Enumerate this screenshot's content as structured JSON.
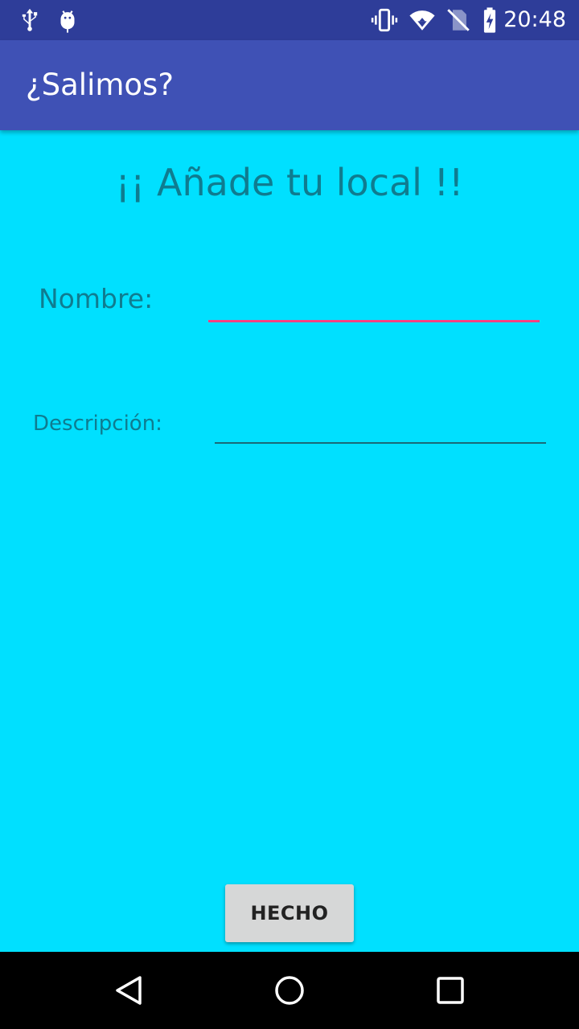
{
  "status_bar": {
    "time": "20:48",
    "left_icons": [
      "usb-icon",
      "android-debug-icon"
    ],
    "right_icons": [
      "vibrate-icon",
      "wifi-icon",
      "no-sim-icon",
      "battery-charging-icon"
    ]
  },
  "app_bar": {
    "title": "¿Salimos?"
  },
  "form": {
    "heading": "¡¡ Añade tu local !!",
    "name_label": "Nombre:",
    "name_value": "",
    "description_label": "Descripción:",
    "description_value": "",
    "done_button": "HECHO"
  },
  "nav_bar": {
    "icons": [
      "back-icon",
      "home-icon",
      "recents-icon"
    ]
  },
  "colors": {
    "status_bar": "#2E3D99",
    "app_bar": "#3F51B5",
    "background": "#00E0FF",
    "text": "#0F7C90",
    "accent": "#FF4081",
    "button": "#D6D7D7"
  }
}
